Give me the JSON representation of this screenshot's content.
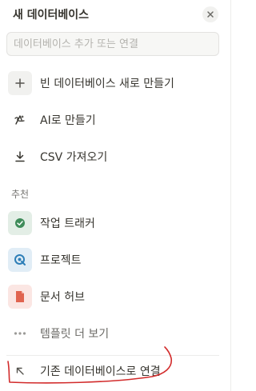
{
  "panel": {
    "title": "새 데이터베이스",
    "search_placeholder": "데이터베이스 추가 또는 연결"
  },
  "actions": [
    {
      "label": "빈 데이터베이스 새로 만들기",
      "icon": "plus-icon"
    },
    {
      "label": "AI로 만들기",
      "icon": "ai-pen-icon"
    },
    {
      "label": "CSV 가져오기",
      "icon": "download-icon"
    }
  ],
  "section": {
    "label": "추천"
  },
  "templates": [
    {
      "label": "작업 트래커",
      "icon": "check-circle-icon",
      "color": "#3f8c5a"
    },
    {
      "label": "프로젝트",
      "icon": "target-icon",
      "color": "#2f7fb8"
    },
    {
      "label": "문서 허브",
      "icon": "document-icon",
      "color": "#e06450"
    }
  ],
  "more": {
    "label": "템플릿 더 보기",
    "icon": "ellipsis-icon"
  },
  "connect": {
    "label": "기존 데이터베이스로 연결",
    "icon": "arrow-up-left-icon"
  },
  "colors": {
    "annotation": "#d22b2b"
  }
}
